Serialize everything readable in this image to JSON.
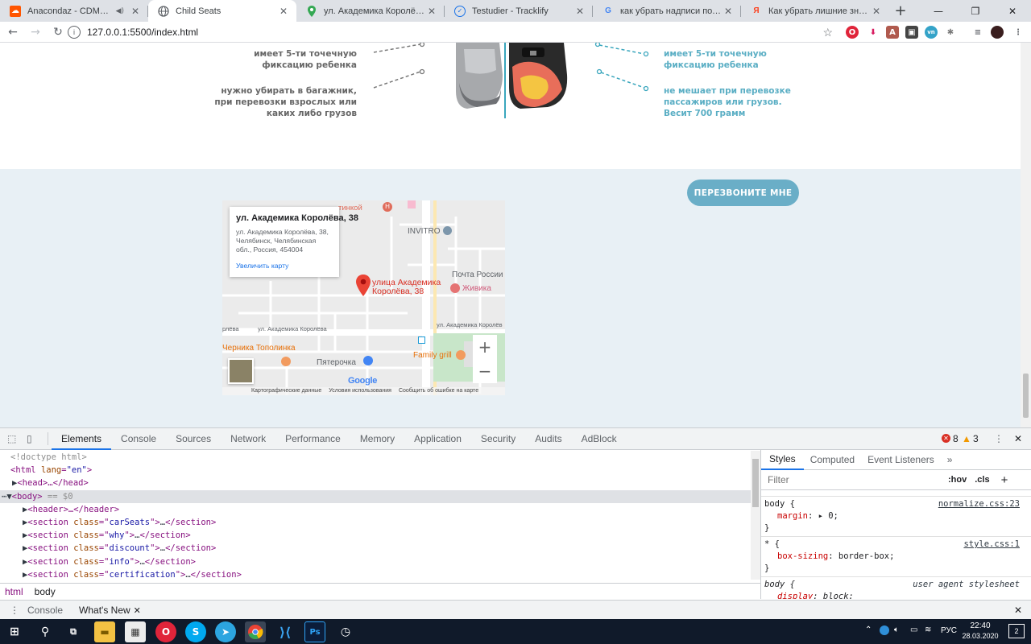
{
  "browser": {
    "tabs": [
      {
        "title": "Anacondaz - CDMM by asd-",
        "icon": "soundcloud-icon",
        "muted": true
      },
      {
        "title": "Child Seats",
        "icon": "globe-icon",
        "active": true
      },
      {
        "title": "ул. Академика Королёва, 38 – G",
        "icon": "google-maps-icon"
      },
      {
        "title": "Testudier - Tracklify",
        "icon": "tracklify-icon"
      },
      {
        "title": "как убрать надписи под гугл кар",
        "icon": "google-icon"
      },
      {
        "title": "Как убрать лишние значки с кар",
        "icon": "yandex-icon"
      }
    ],
    "new_tab": "+",
    "url": "127.0.0.1:5500/index.html",
    "colors": {
      "tabbar": "#dee1e6",
      "accent": "#1a73e8"
    }
  },
  "page": {
    "features_left": [
      {
        "lines": [
          "имеет 5-ти точечную",
          "фиксацию ребенка"
        ]
      },
      {
        "lines": [
          "нужно убирать в багажник,",
          "при перевозки взрослых или",
          "каких либо грузов"
        ]
      }
    ],
    "features_right": [
      {
        "lines": [
          "имеет 5-ти точечную",
          "фиксацию ребенка"
        ]
      },
      {
        "lines": [
          "не мешает при перевозке",
          "пассажиров или грузов.",
          "Весит 700 грамм"
        ]
      }
    ],
    "call_button": "ПЕРЕЗВОНИТЕ МНЕ",
    "colors": {
      "accent": "#6aaec7",
      "band": "#e8f0f5",
      "feature_right": "#5aaec4"
    },
    "map": {
      "card_title": "ул. Академика Королёва, 38",
      "card_address": "ул. Академика Королёва, 38, Челябинск, Челябинская обл., Россия, 454004",
      "card_link": "Увеличить карту",
      "pin_label_1": "улица Академика",
      "pin_label_2": "Королёва, 38",
      "poi_invitro": "INVITRO",
      "poi_pochta": "Почта России",
      "poi_zhivika": "Живика",
      "poi_chernika": "Черника Тополинка",
      "poi_pyaterochka": "Пятерочка",
      "poi_family": "Family grill",
      "poi_top": "тинкой",
      "street_1": "ул. Академика Королёва",
      "street_2": "ул. Академика Королёв",
      "street_edge": "рлёва",
      "google": "Google",
      "footer_data": "Картографические данные",
      "footer_terms": "Условия использования",
      "footer_report": "Сообщить об ошибке на карте",
      "zoom_in": "+",
      "zoom_out": "−"
    }
  },
  "devtools": {
    "tabs": [
      "Elements",
      "Console",
      "Sources",
      "Network",
      "Performance",
      "Memory",
      "Application",
      "Security",
      "Audits",
      "AdBlock"
    ],
    "errors": "8",
    "warnings": "3",
    "dom": {
      "doctype": "<!doctype html>",
      "html_open": "<html",
      "html_attr": "lang",
      "html_val": "\"en\"",
      "head": "<head>…</head>",
      "body": "<body>",
      "body_eq": " == $0",
      "header": "<header>…</header>",
      "sections": [
        "carSeats",
        "why",
        "discount",
        "info",
        "certification"
      ]
    },
    "breadcrumbs": [
      "html",
      "body"
    ],
    "styles_tabs": [
      "Styles",
      "Computed",
      "Event Listeners"
    ],
    "filter_placeholder": "Filter",
    "hov": ":hov",
    "cls": ".cls",
    "rules": [
      {
        "selector": "body {",
        "source": "normalize.css:23",
        "prop": "margin",
        "value": "0;"
      },
      {
        "selector": "* {",
        "source": "style.css:1",
        "prop": "box-sizing",
        "value": "border-box;"
      },
      {
        "selector": "body {",
        "source": "user agent stylesheet",
        "prop": "display",
        "value": "block;"
      }
    ],
    "drawer_tabs": [
      "Console",
      "What's New"
    ]
  },
  "taskbar": {
    "time": "22:40",
    "date": "28.03.2020",
    "lang": "РУС",
    "notifications": "2"
  }
}
